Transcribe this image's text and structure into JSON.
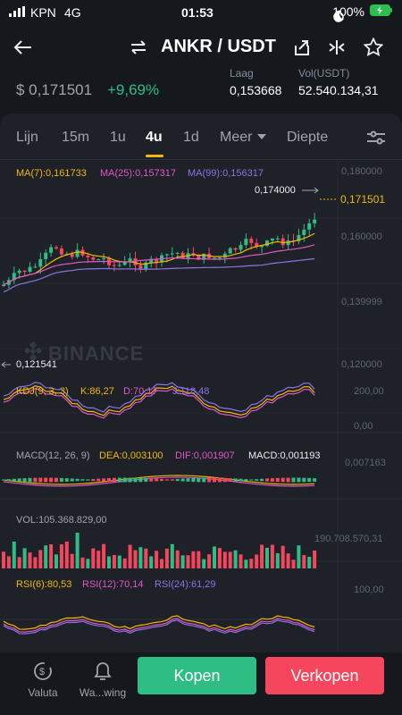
{
  "status_bar": {
    "carrier": "KPN",
    "network": "4G",
    "time": "01:53",
    "battery": "100%"
  },
  "header": {
    "pair": "ANKR / USDT"
  },
  "ticker": {
    "price": "$ 0,171501",
    "change": "+9,69%",
    "low_label": "Laag",
    "low_value": "0,153668",
    "volume_label": "Vol(USDT)",
    "volume_value": "52.540.134,31"
  },
  "tabs": [
    {
      "label": "Lijn"
    },
    {
      "label": "15m"
    },
    {
      "label": "1u"
    },
    {
      "label": "4u"
    },
    {
      "label": "1d"
    },
    {
      "label": "Meer"
    },
    {
      "label": "Diepte"
    }
  ],
  "active_tab": "4u",
  "main_chart": {
    "ma7": "MA(7):0,161733",
    "ma25": "MA(25):0,157317",
    "ma99": "MA(99):0,156317",
    "axis": [
      "0,180000",
      "0,160000",
      "0,139999",
      "0,120000"
    ],
    "high_marker": "0,174000",
    "low_marker": "0,121541",
    "current_price": "0,171501",
    "watermark": "BINANCE"
  },
  "kdj": {
    "title": "KDJ(9, 3, 3)",
    "k": "K:86,27",
    "d": "D:70,17",
    "j": "J:118,48",
    "axis_top": "200,00",
    "axis_bottom": "0,00"
  },
  "macd": {
    "title": "MACD(12, 26, 9)",
    "dea": "DEA:0,003100",
    "dif": "DIF:0,001907",
    "macd": "MACD:0,001193",
    "axis": "0,007163"
  },
  "volume": {
    "title": "VOL:105.368.829,00",
    "axis": "190.708.570,31"
  },
  "rsi": {
    "rsi6": "RSI(6):80,53",
    "rsi12": "RSI(12):70,14",
    "rsi24": "RSI(24):61,29",
    "axis": "100,00"
  },
  "bottom_nav": {
    "valuta": "Valuta",
    "waarschuwing": "Wa...wing",
    "buy": "Kopen",
    "sell": "Verkopen"
  },
  "colors": {
    "up": "#2ebd85",
    "down": "#f6465d",
    "ma7": "#f0b90b",
    "ma25": "#e057c8",
    "ma99": "#8b73e6",
    "accent": "#f0b90b"
  }
}
